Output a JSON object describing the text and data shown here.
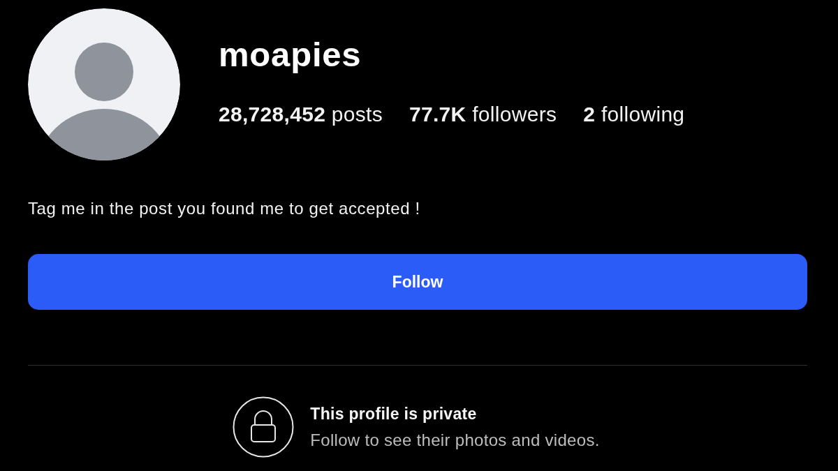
{
  "profile": {
    "username": "moapies",
    "stats": [
      "**28,728,452** posts",
      "**77.7K** followers",
      "**2** following"
    ],
    "bio": "Tag me in the post you found me to get accepted !"
  },
  "follow_button": {
    "label": "Follow"
  },
  "private_notice": {
    "title": "This profile is private",
    "subtitle": "Follow to see their photos and videos."
  }
}
